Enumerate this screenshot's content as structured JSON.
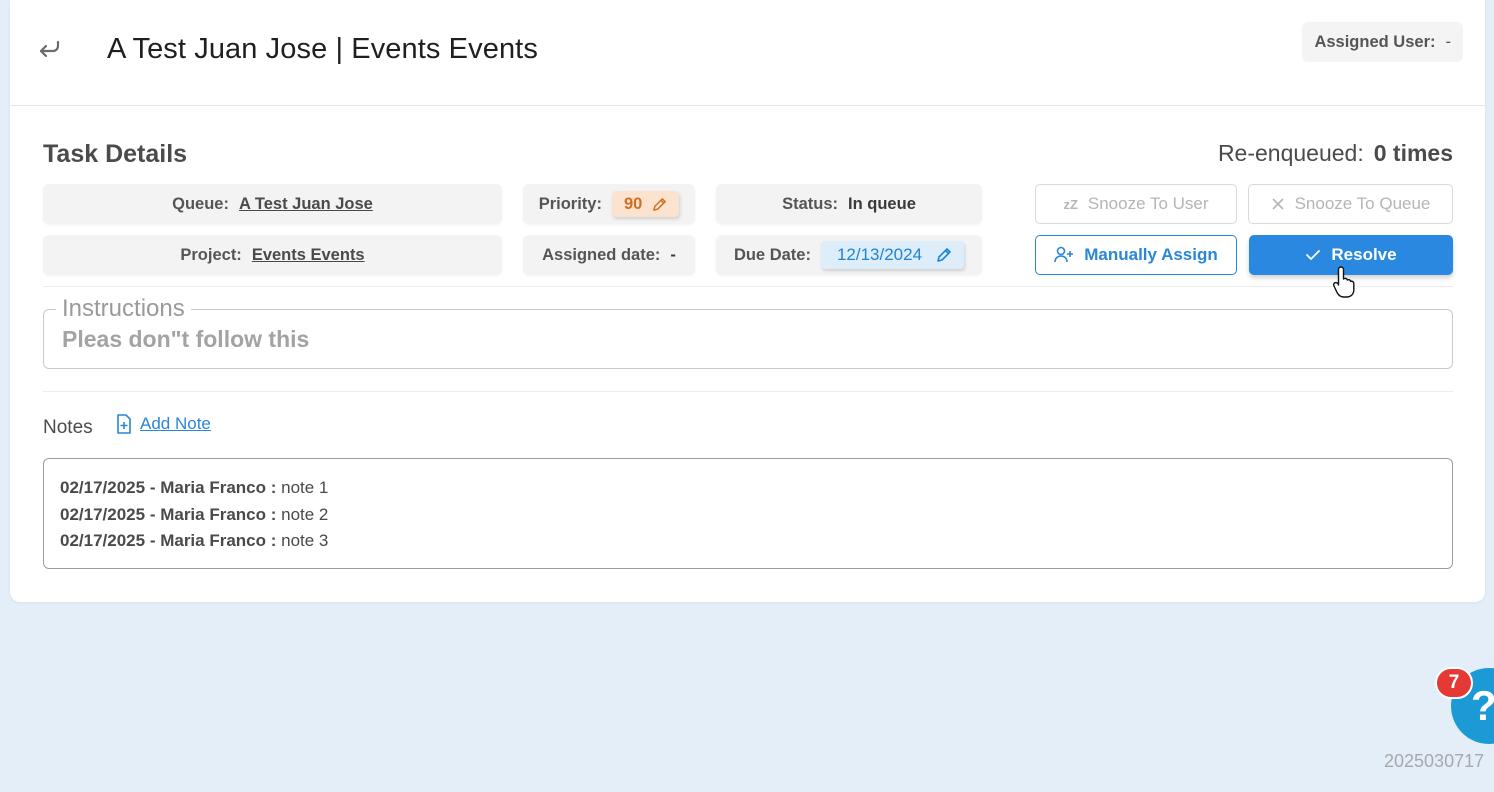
{
  "header": {
    "title": "A Test Juan Jose | Events Events",
    "assigned_user_label": "Assigned User:",
    "assigned_user_value": "-"
  },
  "task": {
    "section_title": "Task Details",
    "reenqueued_label": "Re-enqueued:",
    "reenqueued_value": "0 times",
    "queue_label": "Queue:",
    "queue_value": "A Test Juan Jose",
    "project_label": "Project:",
    "project_value": "Events Events",
    "priority_label": "Priority:",
    "priority_value": "90",
    "assigned_date_label": "Assigned date:",
    "assigned_date_value": "-",
    "status_label": "Status:",
    "status_value": "In queue",
    "due_date_label": "Due Date:",
    "due_date_value": "12/13/2024"
  },
  "actions": {
    "snooze_user": "Snooze To User",
    "snooze_user_icon_text": "zZ",
    "snooze_queue": "Snooze To Queue",
    "manually_assign": "Manually Assign",
    "resolve": "Resolve"
  },
  "instructions": {
    "legend": "Instructions",
    "text": "Pleas don\"t follow this"
  },
  "notes": {
    "label": "Notes",
    "add_note": "Add Note",
    "items": [
      {
        "date": "02/17/2025",
        "author": "Maria Franco",
        "text": "note 1"
      },
      {
        "date": "02/17/2025",
        "author": "Maria Franco",
        "text": "note 2"
      },
      {
        "date": "02/17/2025",
        "author": "Maria Franco",
        "text": "note 3"
      }
    ]
  },
  "help": {
    "badge_count": "7",
    "icon": "?",
    "version": "2025030717"
  },
  "colors": {
    "accent": "#2b88e0",
    "priority": "#cf6f22",
    "badge": "#e53935",
    "fab": "#1c9ad6"
  }
}
